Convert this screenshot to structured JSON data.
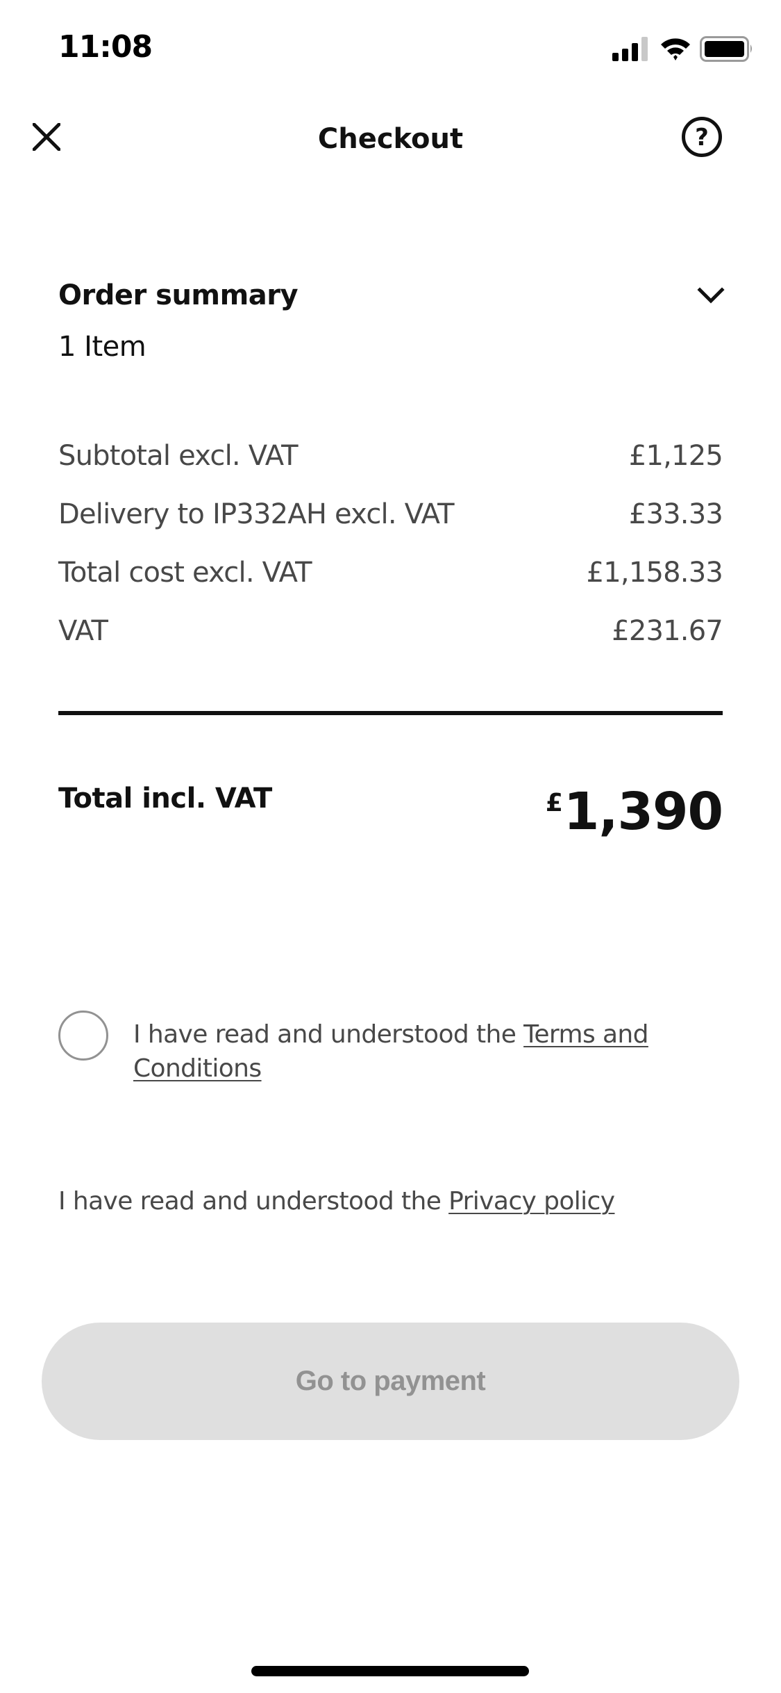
{
  "status_bar": {
    "time": "11:08",
    "signal_bars_filled": 3,
    "signal_bars_total": 4,
    "wifi": "wifi-icon",
    "battery_level": 0.9
  },
  "nav": {
    "close_icon": "close-icon",
    "title": "Checkout",
    "help_icon": "help-icon",
    "help_glyph": "?"
  },
  "order_summary": {
    "title": "Order summary",
    "item_count": "1 Item",
    "expand_icon": "chevron-down-icon",
    "line_items": [
      {
        "label": "Subtotal excl. VAT",
        "value": "£1,125"
      },
      {
        "label": "Delivery to IP332AH excl. VAT",
        "value": "£33.33"
      },
      {
        "label": "Total cost excl. VAT",
        "value": "£1,158.33"
      },
      {
        "label": "VAT",
        "value": "£231.67"
      }
    ],
    "total_label": "Total incl. VAT",
    "total_currency": "£",
    "total_amount": "1,390"
  },
  "consent": {
    "terms_checked": false,
    "terms_prefix": "I have read and understood the ",
    "terms_link": "Terms and Conditions",
    "privacy_prefix": "I have read and understood the ",
    "privacy_link": "Privacy policy"
  },
  "actions": {
    "pay_label": "Go to payment",
    "pay_enabled": false
  },
  "colors": {
    "text_primary": "#111111",
    "text_secondary": "#484848",
    "button_disabled_bg": "#dfdfdf",
    "button_disabled_text": "#929292",
    "checkbox_border": "#929292"
  }
}
